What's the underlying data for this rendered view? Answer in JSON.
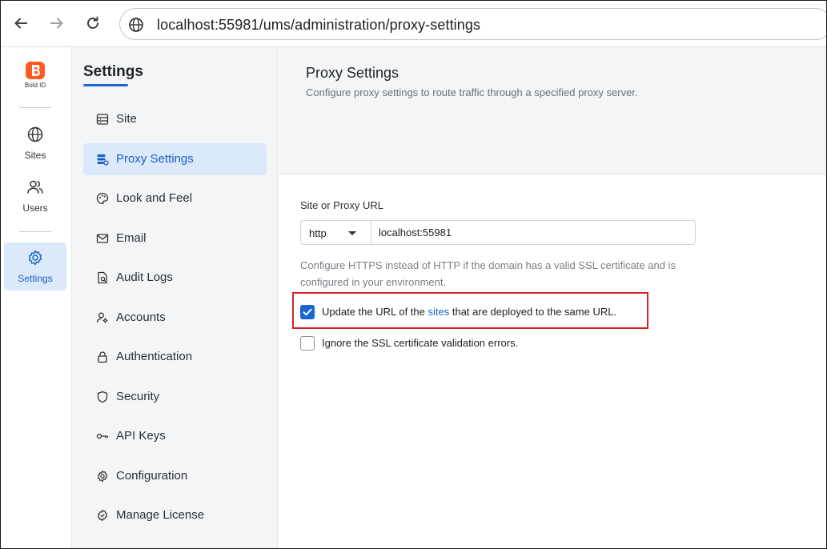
{
  "browser": {
    "url": "localhost:55981/ums/administration/proxy-settings"
  },
  "rail": {
    "logo_text": "Bold ID",
    "items": [
      {
        "label": "Sites",
        "icon": "globe-icon"
      },
      {
        "label": "Users",
        "icon": "users-icon"
      },
      {
        "label": "Settings",
        "icon": "gear-icon",
        "active": true
      }
    ]
  },
  "settings_menu": {
    "title": "Settings",
    "items": [
      {
        "label": "Site",
        "icon": "site-icon"
      },
      {
        "label": "Proxy Settings",
        "icon": "proxy-icon",
        "active": true
      },
      {
        "label": "Look and Feel",
        "icon": "palette-icon"
      },
      {
        "label": "Email",
        "icon": "mail-icon"
      },
      {
        "label": "Audit Logs",
        "icon": "audit-log-icon"
      },
      {
        "label": "Accounts",
        "icon": "accounts-icon"
      },
      {
        "label": "Authentication",
        "icon": "lock-icon"
      },
      {
        "label": "Security",
        "icon": "shield-icon"
      },
      {
        "label": "API Keys",
        "icon": "key-icon"
      },
      {
        "label": "Configuration",
        "icon": "cog-icon"
      },
      {
        "label": "Manage License",
        "icon": "license-icon"
      }
    ]
  },
  "main": {
    "title": "Proxy Settings",
    "subtitle": "Configure proxy settings to route traffic through a specified proxy server.",
    "url_field": {
      "label": "Site or Proxy URL",
      "protocol": "http",
      "value": "localhost:55981"
    },
    "hint": "Configure HTTPS instead of HTTP if the domain has a valid SSL certificate and is configured in your environment.",
    "update_urls": {
      "checked": true,
      "text_before": "Update the URL of the ",
      "link_text": "sites",
      "text_after": " that are deployed to the same URL."
    },
    "ignore_ssl": {
      "checked": false,
      "text": "Ignore the SSL certificate validation errors."
    }
  },
  "colors": {
    "accent": "#1a64d4",
    "active_bg": "#dbe9fb",
    "highlight_border": "#d92027",
    "logo": "#ff5a1f"
  }
}
